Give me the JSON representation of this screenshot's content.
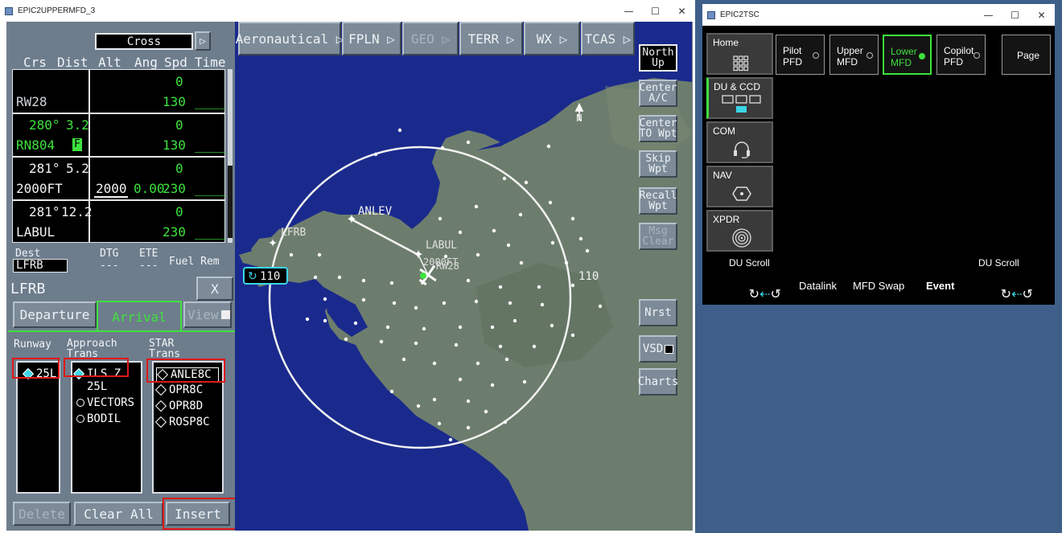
{
  "mfd_window": {
    "title": "EPIC2UPPERMFD_3"
  },
  "tsc_window": {
    "title": "EPIC2TSC"
  },
  "window_controls": {
    "minimize": "—",
    "maximize": "☐",
    "close": "✕"
  },
  "fpl": {
    "mode_value": "Cross",
    "columns": [
      "Crs",
      "Dist",
      "Alt",
      "Ang",
      "Spd",
      "Time"
    ],
    "rows": [
      {
        "crs": "",
        "dist": "",
        "name": "RW28",
        "alt": "",
        "ang": "",
        "upper": "0",
        "spd": "130",
        "time": "____"
      },
      {
        "crs": "280°",
        "dist": "3.2",
        "name": "RN804",
        "flag": "F",
        "alt": "",
        "ang": "",
        "upper": "0",
        "spd": "130",
        "time": "____"
      },
      {
        "crs": "281°",
        "dist": "5.2",
        "name": "2000FT",
        "alt": "2000",
        "ang": "0.00",
        "upper": "0",
        "spd": "230",
        "time": "____"
      },
      {
        "crs": "281°",
        "dist": "12.2",
        "name": "LABUL",
        "alt": "",
        "ang": "",
        "upper": "0",
        "spd": "230",
        "time": "____"
      }
    ],
    "dest_label": "Dest",
    "dest_value": "LFRB",
    "dtg_label": "DTG",
    "dtg_value": "---",
    "ete_label": "ETE",
    "ete_value": "---",
    "fuel_label": "Fuel Rem"
  },
  "procedure": {
    "airport": "LFRB",
    "close": "X",
    "tabs": {
      "departure": "Departure",
      "arrival": "Arrival",
      "view": "View"
    },
    "runway": {
      "header": "Runway",
      "items": [
        "25L"
      ]
    },
    "approach": {
      "header": "Approach\nTrans",
      "items": [
        "ILS Z",
        "25L",
        "VECTORS",
        "BODIL"
      ]
    },
    "star": {
      "header": "STAR\nTrans",
      "items": [
        "ANLE8C",
        "OPR8C",
        "OPR8D",
        "ROSP8C"
      ]
    },
    "buttons": {
      "delete": "Delete",
      "clear_all": "Clear All",
      "insert": "Insert"
    }
  },
  "menu": [
    "Aeronautical",
    "FPLN",
    "GEO",
    "TERR",
    "WX",
    "TCAS"
  ],
  "right_buttons": {
    "north_up": "North\nUp",
    "center_ac": "Center\nA/C",
    "center_to_wpt": "Center\nTO Wpt",
    "skip_wpt": "Skip\nWpt",
    "recall_wpt": "Recall\nWpt",
    "msg_clear": "Msg\nClear",
    "nrst": "Nrst",
    "vsd": "VSD",
    "charts": "Charts"
  },
  "map": {
    "north": "N",
    "range_left": "110",
    "range_right": "110",
    "waypoints": {
      "anlev": "ANLEV",
      "labul": "LABUL",
      "lfrb": "LFRB",
      "alt": "2000FT",
      "rw": "RW28"
    },
    "colors": {
      "sea": "#1a2a8c",
      "land": "#6d7d6d",
      "route": "#f2f2f2",
      "range_ring": "#f2f2f2",
      "range_box": "#3cd6e8"
    }
  },
  "tsc": {
    "home": "Home",
    "du_ccd": "DU & CCD",
    "com": "COM",
    "nav": "NAV",
    "xpdr": "XPDR",
    "pilot_pfd": "Pilot\nPFD",
    "upper_mfd": "Upper\nMFD",
    "lower_mfd": "Lower\nMFD",
    "copilot_pfd": "Copilot\nPFD",
    "page": "Page",
    "du_scroll_left": "DU Scroll",
    "du_scroll_right": "DU Scroll",
    "datalink": "Datalink",
    "mfd_swap": "MFD Swap",
    "event": "Event"
  },
  "colors": {
    "green": "#3ee23e",
    "cyan": "#3cd6e8",
    "red_highlight": "#e01818",
    "desktop": "#3e5f8a"
  }
}
